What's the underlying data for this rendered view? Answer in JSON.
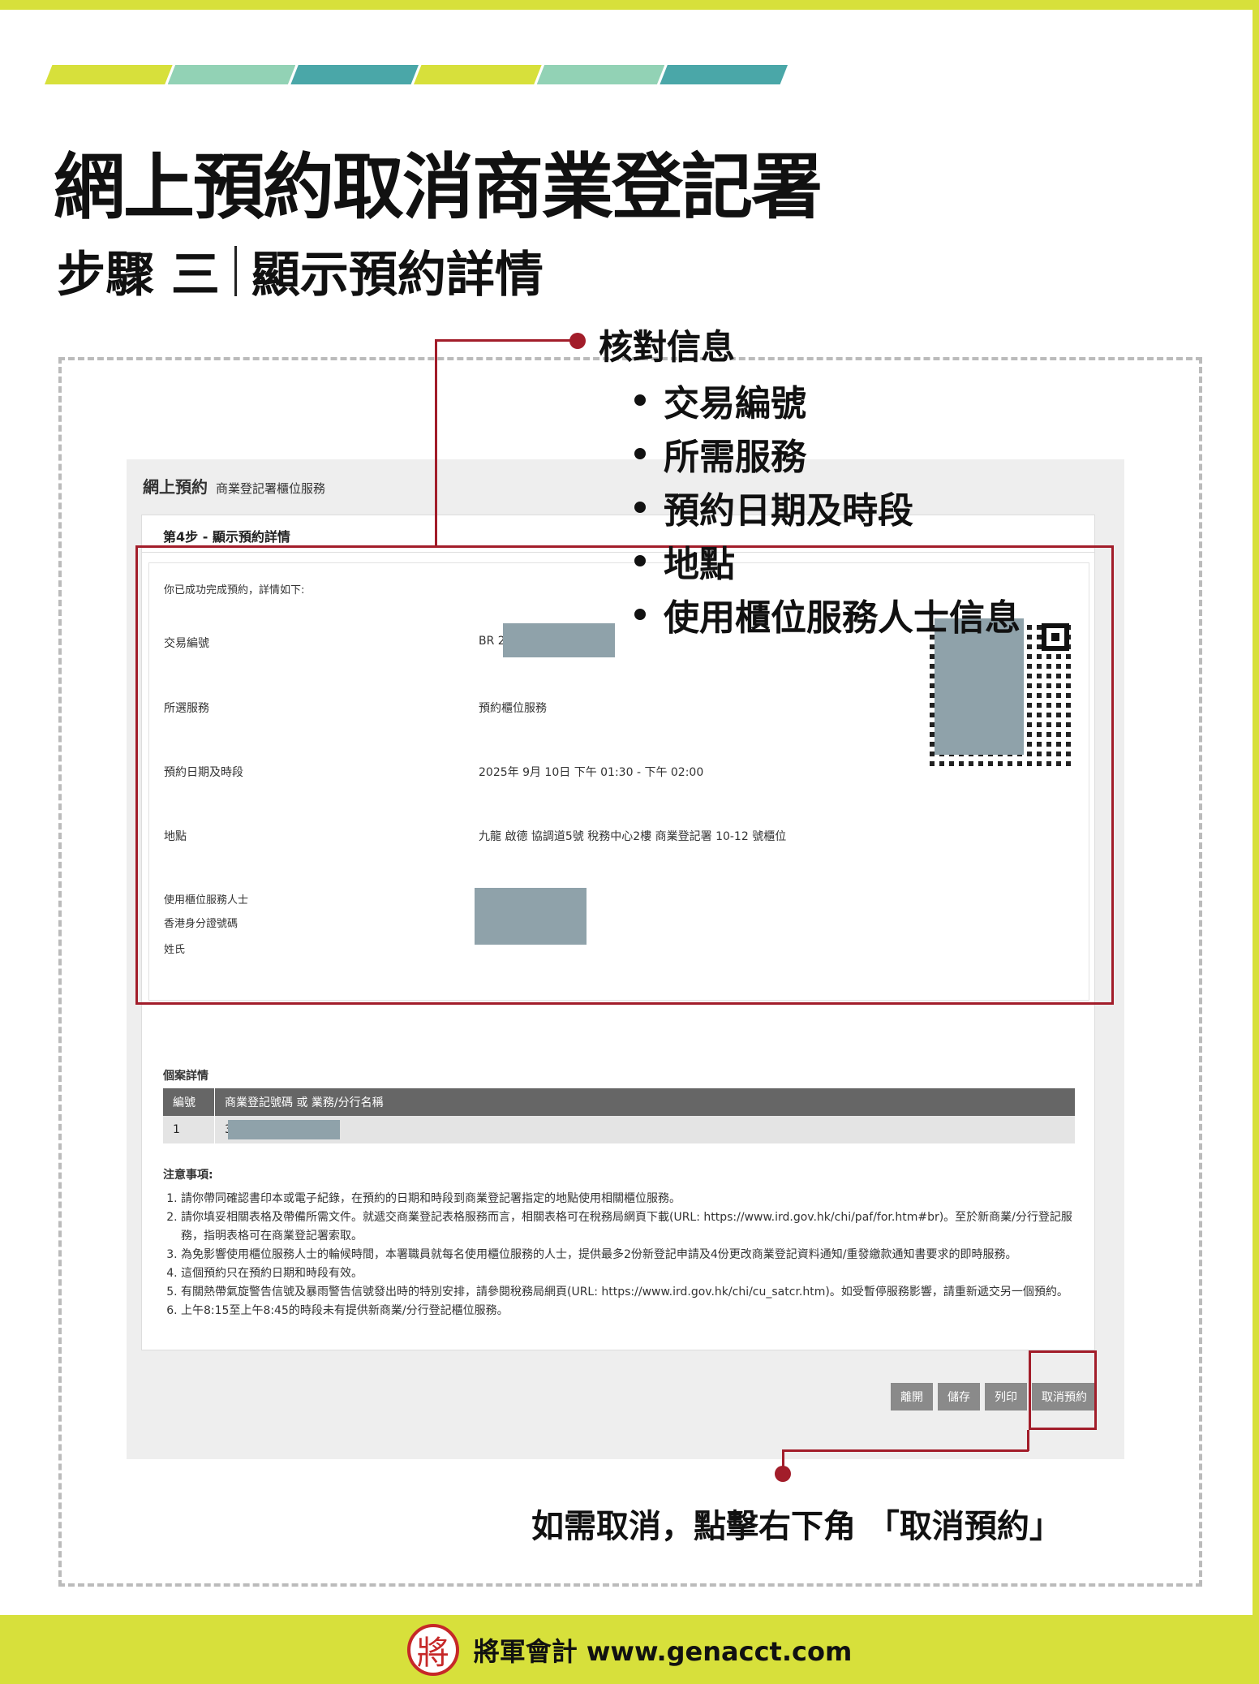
{
  "header": {
    "title": "網上預約取消商業登記署",
    "subtitle_step": "步驟 三",
    "subtitle_text": "顯示預約詳情"
  },
  "stripe_colors": [
    "#d7e03b",
    "#92d2b5",
    "#4aa7a8",
    "#d7e03b",
    "#92d2b5",
    "#4aa7a8"
  ],
  "accent_red": "#a21d2a",
  "callout": {
    "heading": "核對信息",
    "items": [
      "交易編號",
      "所需服務",
      "預約日期及時段",
      "地點",
      "使用櫃位服務人士信息"
    ],
    "cancel_note": "如需取消，點擊右下角 「取消預約」"
  },
  "app": {
    "title": "網上預約",
    "subtitle": "商業登記署櫃位服務",
    "step_title": "第4步 - 顯示預約詳情",
    "success_msg": "你已成功完成預約，詳情如下:",
    "fields": {
      "txn_label": "交易編號",
      "txn_value": "BR 2",
      "service_label": "所選服務",
      "service_value": "預約櫃位服務",
      "date_label": "預約日期及時段",
      "date_value": "2025年 9月 10日 下午 01:30 - 下午 02:00",
      "location_label": "地點",
      "location_value": "九龍 啟德 協調道5號 稅務中心2樓 商業登記署 10-12 號櫃位",
      "person_label": "使用櫃位服務人士",
      "id_label": "香港身分證號碼",
      "name_label": "姓氏"
    },
    "case_title": "個案詳情",
    "table": {
      "headers": [
        "編號",
        "商業登記號碼 或 業務/分行名稱"
      ],
      "rows": [
        [
          "1",
          "3"
        ]
      ]
    },
    "notes_title": "注意事項:",
    "notes": [
      "請你帶同確認書印本或電子紀錄，在預約的日期和時段到商業登記署指定的地點使用相關櫃位服務。",
      "請你填妥相關表格及帶備所需文件。就遞交商業登記表格服務而言，相關表格可在稅務局網頁下載(URL: https://www.ird.gov.hk/chi/paf/for.htm#br)。至於新商業/分行登記服務，指明表格可在商業登記署索取。",
      "為免影響使用櫃位服務人士的輪候時間，本署職員就每名使用櫃位服務的人士，提供最多2份新登記申請及4份更改商業登記資料通知/重發繳款通知書要求的即時服務。",
      "這個預約只在預約日期和時段有效。",
      "有關熱帶氣旋警告信號及暴雨警告信號發出時的特別安排，請參閱稅務局網頁(URL: https://www.ird.gov.hk/chi/cu_satcr.htm)。如受暫停服務影響，請重新遞交另一個預約。",
      "上午8:15至上午8:45的時段未有提供新商業/分行登記櫃位服務。"
    ],
    "buttons": {
      "leave": "離開",
      "save": "儲存",
      "print": "列印",
      "cancel": "取消預約"
    }
  },
  "footer": {
    "logo_char": "將",
    "text": "將軍會計 www.genacct.com"
  }
}
